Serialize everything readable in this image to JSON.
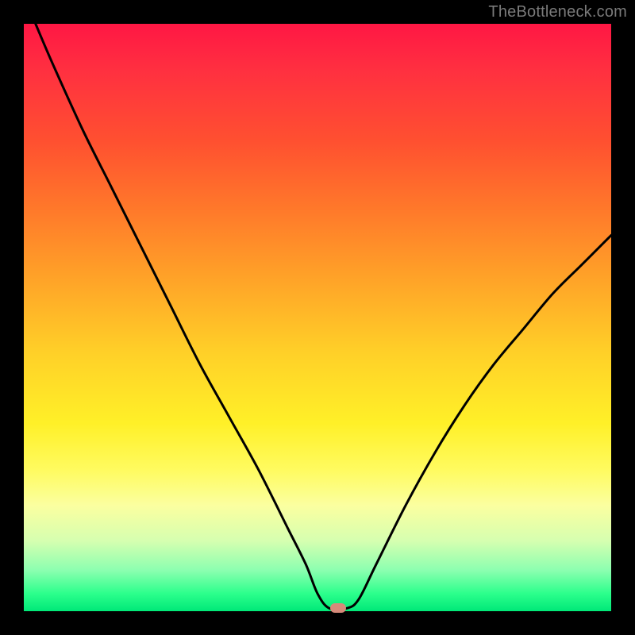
{
  "watermark": "TheBottleneck.com",
  "colors": {
    "frame": "#000000",
    "curve": "#000000",
    "marker": "#d68a7a"
  },
  "chart_data": {
    "type": "line",
    "title": "",
    "xlabel": "",
    "ylabel": "",
    "xlim": [
      0,
      100
    ],
    "ylim": [
      0,
      100
    ],
    "series": [
      {
        "name": "bottleneck-curve",
        "x": [
          2,
          5,
          10,
          15,
          20,
          25,
          30,
          35,
          40,
          45,
          48,
          50,
          52,
          55,
          57,
          60,
          65,
          70,
          75,
          80,
          85,
          90,
          95,
          100
        ],
        "y": [
          100,
          93,
          82,
          72,
          62,
          52,
          42,
          33,
          24,
          14,
          8,
          3,
          0.5,
          0.5,
          2,
          8,
          18,
          27,
          35,
          42,
          48,
          54,
          59,
          64
        ]
      }
    ],
    "marker": {
      "x": 53.5,
      "y": 0.5
    },
    "gradient_stops": [
      {
        "pos": 0,
        "color": "#ff1744"
      },
      {
        "pos": 8,
        "color": "#ff3040"
      },
      {
        "pos": 20,
        "color": "#ff5030"
      },
      {
        "pos": 32,
        "color": "#ff7a2a"
      },
      {
        "pos": 44,
        "color": "#ffa528"
      },
      {
        "pos": 56,
        "color": "#ffd028"
      },
      {
        "pos": 68,
        "color": "#fff028"
      },
      {
        "pos": 76,
        "color": "#fffb60"
      },
      {
        "pos": 82,
        "color": "#fbffa0"
      },
      {
        "pos": 88,
        "color": "#d6ffb0"
      },
      {
        "pos": 93,
        "color": "#8cffb0"
      },
      {
        "pos": 97,
        "color": "#2cff8c"
      },
      {
        "pos": 100,
        "color": "#00e878"
      }
    ]
  }
}
